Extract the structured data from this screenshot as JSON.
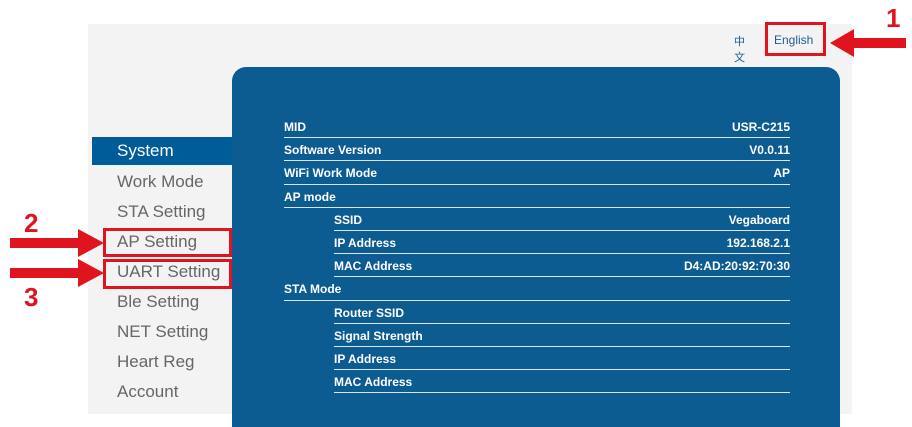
{
  "lang": {
    "zh": "中文",
    "en": "English"
  },
  "annotations": [
    "1",
    "2",
    "3"
  ],
  "sidebar": {
    "items": [
      {
        "label": "System",
        "active": true
      },
      {
        "label": "Work Mode"
      },
      {
        "label": "STA Setting"
      },
      {
        "label": "AP Setting"
      },
      {
        "label": "UART Setting"
      },
      {
        "label": "Ble Setting"
      },
      {
        "label": "NET Setting"
      },
      {
        "label": "Heart Reg"
      },
      {
        "label": "Account"
      }
    ]
  },
  "info": {
    "mid": {
      "label": "MID",
      "value": "USR-C215"
    },
    "software_version": {
      "label": "Software Version",
      "value": "V0.0.11"
    },
    "wifi_work_mode": {
      "label": "WiFi Work Mode",
      "value": "AP"
    },
    "ap_mode": {
      "label": "AP mode"
    },
    "ap_ssid": {
      "label": "SSID",
      "value": "Vegaboard"
    },
    "ap_ip": {
      "label": "IP Address",
      "value": "192.168.2.1"
    },
    "ap_mac": {
      "label": "MAC Address",
      "value": "D4:AD:20:92:70:30"
    },
    "sta_mode": {
      "label": "STA Mode"
    },
    "sta_router_ssid": {
      "label": "Router SSID",
      "value": ""
    },
    "sta_signal": {
      "label": "Signal Strength",
      "value": ""
    },
    "sta_ip": {
      "label": "IP Address",
      "value": ""
    },
    "sta_mac": {
      "label": "MAC Address",
      "value": ""
    }
  },
  "colors": {
    "panel": "#0d5c91",
    "active_nav": "#005c99",
    "annotation": "#e0141e",
    "link": "#1e5d8f"
  }
}
